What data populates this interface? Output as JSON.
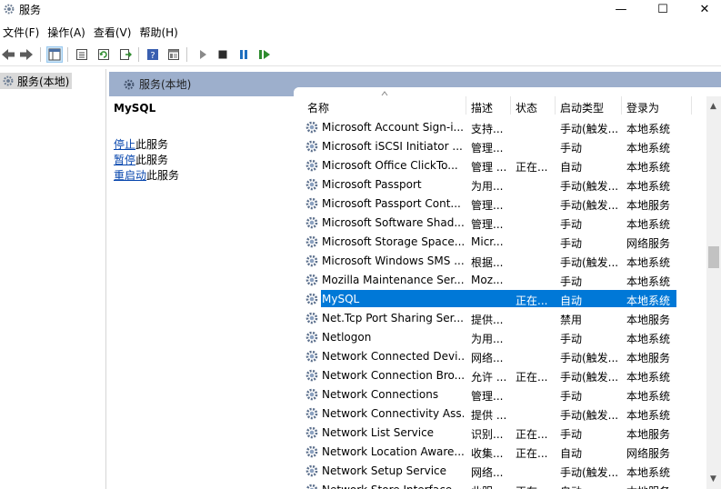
{
  "window": {
    "title": "服务",
    "controls": {
      "minimize": "—",
      "maximize": "☐",
      "close": "✕"
    }
  },
  "menu": [
    "文件(F)",
    "操作(A)",
    "查看(V)",
    "帮助(H)"
  ],
  "toolbar": {
    "icons": [
      "back-icon",
      "forward-icon",
      "show-hide-tree-icon",
      "properties-icon",
      "refresh-icon",
      "export-list-icon",
      "help-icon",
      "view-icon",
      "start-icon",
      "stop-icon",
      "pause-icon",
      "resume-icon"
    ]
  },
  "tree": {
    "selected_item": "服务(本地)"
  },
  "header": {
    "title": "服务(本地)"
  },
  "description_pane": {
    "service_name": "MySQL",
    "actions": [
      {
        "link": "停止",
        "text": "此服务"
      },
      {
        "link": "暂停",
        "text": "此服务"
      },
      {
        "link": "重启动",
        "text": "此服务"
      }
    ]
  },
  "columns": {
    "name": "名称",
    "description": "描述",
    "status": "状态",
    "startup": "启动类型",
    "logon": "登录为"
  },
  "services": [
    {
      "name": "Microsoft Account Sign-i...",
      "description": "支持...",
      "status": "",
      "startup": "手动(触发...",
      "logon": "本地系统"
    },
    {
      "name": "Microsoft iSCSI Initiator ...",
      "description": "管理...",
      "status": "",
      "startup": "手动",
      "logon": "本地系统"
    },
    {
      "name": "Microsoft Office ClickTo...",
      "description": "管理 ...",
      "status": "正在...",
      "startup": "自动",
      "logon": "本地系统"
    },
    {
      "name": "Microsoft Passport",
      "description": "为用...",
      "status": "",
      "startup": "手动(触发...",
      "logon": "本地系统"
    },
    {
      "name": "Microsoft Passport Cont...",
      "description": "管理...",
      "status": "",
      "startup": "手动(触发...",
      "logon": "本地服务"
    },
    {
      "name": "Microsoft Software Shad...",
      "description": "管理...",
      "status": "",
      "startup": "手动",
      "logon": "本地系统"
    },
    {
      "name": "Microsoft Storage Space...",
      "description": "Micr...",
      "status": "",
      "startup": "手动",
      "logon": "网络服务"
    },
    {
      "name": "Microsoft Windows SMS ...",
      "description": "根据...",
      "status": "",
      "startup": "手动(触发...",
      "logon": "本地系统"
    },
    {
      "name": "Mozilla Maintenance Ser...",
      "description": "Moz...",
      "status": "",
      "startup": "手动",
      "logon": "本地系统"
    },
    {
      "name": "MySQL",
      "description": "",
      "status": "正在...",
      "startup": "自动",
      "logon": "本地系统",
      "selected": true
    },
    {
      "name": "Net.Tcp Port Sharing Ser...",
      "description": "提供...",
      "status": "",
      "startup": "禁用",
      "logon": "本地服务"
    },
    {
      "name": "Netlogon",
      "description": "为用...",
      "status": "",
      "startup": "手动",
      "logon": "本地系统"
    },
    {
      "name": "Network Connected Devi...",
      "description": "网络...",
      "status": "",
      "startup": "手动(触发...",
      "logon": "本地服务"
    },
    {
      "name": "Network Connection Bro...",
      "description": "允许 ...",
      "status": "正在...",
      "startup": "手动(触发...",
      "logon": "本地系统"
    },
    {
      "name": "Network Connections",
      "description": "管理...",
      "status": "",
      "startup": "手动",
      "logon": "本地系统"
    },
    {
      "name": "Network Connectivity Ass...",
      "description": "提供 ...",
      "status": "",
      "startup": "手动(触发...",
      "logon": "本地系统"
    },
    {
      "name": "Network List Service",
      "description": "识别...",
      "status": "正在...",
      "startup": "手动",
      "logon": "本地服务"
    },
    {
      "name": "Network Location Aware...",
      "description": "收集...",
      "status": "正在...",
      "startup": "自动",
      "logon": "网络服务"
    },
    {
      "name": "Network Setup Service",
      "description": "网络...",
      "status": "",
      "startup": "手动(触发...",
      "logon": "本地系统"
    },
    {
      "name": "Network Store Interface ...",
      "description": "此服...",
      "status": "正在...",
      "startup": "自动",
      "logon": "本地服务"
    }
  ],
  "colors": {
    "selection": "#0078d7",
    "header_band": "#9dafcc",
    "link": "#0645ad"
  }
}
